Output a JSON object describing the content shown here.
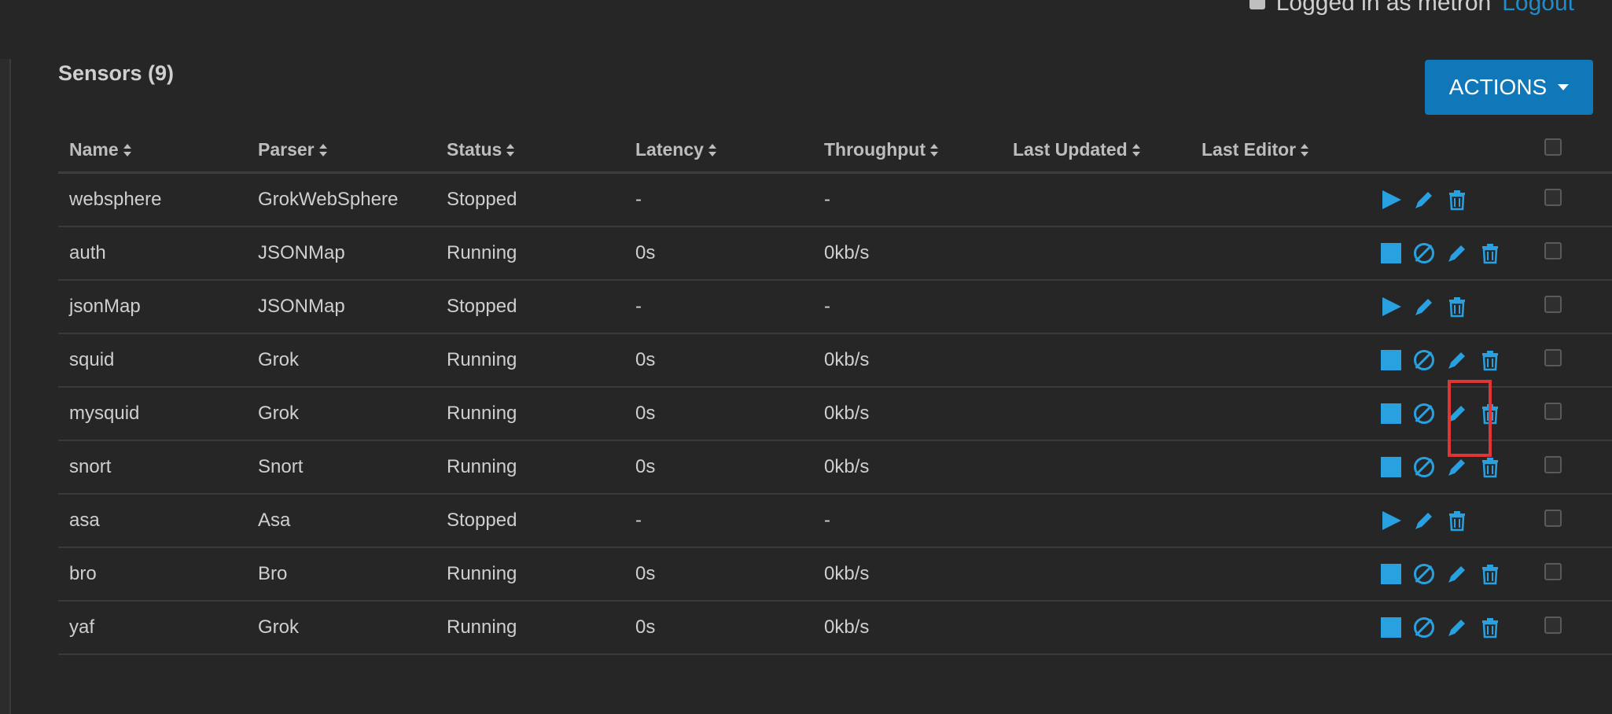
{
  "header": {
    "logged_in_text": "Logged in as metron",
    "logout_label": "Logout"
  },
  "page": {
    "title": "Sensors (9)",
    "actions_button_label": "ACTIONS"
  },
  "table": {
    "columns": [
      "Name",
      "Parser",
      "Status",
      "Latency",
      "Throughput",
      "Last Updated",
      "Last Editor"
    ],
    "rows": [
      {
        "name": "websphere",
        "parser": "GrokWebSphere",
        "status": "Stopped",
        "latency": "-",
        "throughput": "-",
        "last_updated": "",
        "last_editor": "",
        "actions": [
          "start",
          "edit",
          "delete"
        ]
      },
      {
        "name": "auth",
        "parser": "JSONMap",
        "status": "Running",
        "latency": "0s",
        "throughput": "0kb/s",
        "last_updated": "",
        "last_editor": "",
        "actions": [
          "stop",
          "disable",
          "edit",
          "delete"
        ]
      },
      {
        "name": "jsonMap",
        "parser": "JSONMap",
        "status": "Stopped",
        "latency": "-",
        "throughput": "-",
        "last_updated": "",
        "last_editor": "",
        "actions": [
          "start",
          "edit",
          "delete"
        ]
      },
      {
        "name": "squid",
        "parser": "Grok",
        "status": "Running",
        "latency": "0s",
        "throughput": "0kb/s",
        "last_updated": "",
        "last_editor": "",
        "actions": [
          "stop",
          "disable",
          "edit",
          "delete"
        ]
      },
      {
        "name": "mysquid",
        "parser": "Grok",
        "status": "Running",
        "latency": "0s",
        "throughput": "0kb/s",
        "last_updated": "",
        "last_editor": "",
        "actions": [
          "stop",
          "disable",
          "edit",
          "delete"
        ]
      },
      {
        "name": "snort",
        "parser": "Snort",
        "status": "Running",
        "latency": "0s",
        "throughput": "0kb/s",
        "last_updated": "",
        "last_editor": "",
        "actions": [
          "stop",
          "disable",
          "edit",
          "delete"
        ]
      },
      {
        "name": "asa",
        "parser": "Asa",
        "status": "Stopped",
        "latency": "-",
        "throughput": "-",
        "last_updated": "",
        "last_editor": "",
        "actions": [
          "start",
          "edit",
          "delete"
        ]
      },
      {
        "name": "bro",
        "parser": "Bro",
        "status": "Running",
        "latency": "0s",
        "throughput": "0kb/s",
        "last_updated": "",
        "last_editor": "",
        "actions": [
          "stop",
          "disable",
          "edit",
          "delete"
        ]
      },
      {
        "name": "yaf",
        "parser": "Grok",
        "status": "Running",
        "latency": "0s",
        "throughput": "0kb/s",
        "last_updated": "",
        "last_editor": "",
        "actions": [
          "stop",
          "disable",
          "edit",
          "delete"
        ]
      }
    ]
  },
  "colors": {
    "background": "#262626",
    "accent": "#29a1e0",
    "actions_button": "#1077b8",
    "stopped": "#e0762a",
    "highlight": "#e03535"
  }
}
